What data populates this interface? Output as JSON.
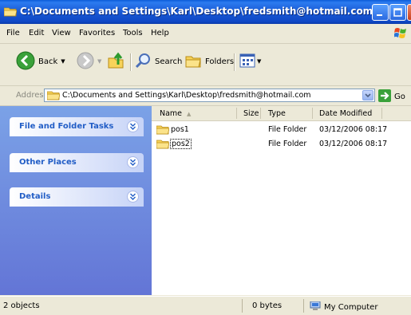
{
  "window": {
    "title": "C:\\Documents and Settings\\Karl\\Desktop\\fredsmith@hotmail.com"
  },
  "menu": {
    "items": [
      {
        "label": "File"
      },
      {
        "label": "Edit"
      },
      {
        "label": "View"
      },
      {
        "label": "Favorites"
      },
      {
        "label": "Tools"
      },
      {
        "label": "Help"
      }
    ]
  },
  "toolbar": {
    "back_label": "Back",
    "search_label": "Search",
    "folders_label": "Folders"
  },
  "address": {
    "label": "Address",
    "value": "C:\\Documents and Settings\\Karl\\Desktop\\fredsmith@hotmail.com",
    "go_label": "Go"
  },
  "taskpane": {
    "panels": [
      {
        "title": "File and Folder Tasks"
      },
      {
        "title": "Other Places"
      },
      {
        "title": "Details"
      }
    ]
  },
  "filelist": {
    "columns": [
      "Name",
      "Size",
      "Type",
      "Date Modified"
    ],
    "rows": [
      {
        "name": "pos1",
        "size": "",
        "type": "File Folder",
        "date": "03/12/2006 08:17"
      },
      {
        "name": "pos2",
        "size": "",
        "type": "File Folder",
        "date": "03/12/2006 08:17"
      }
    ]
  },
  "status": {
    "objects": "2 objects",
    "size": "0 bytes",
    "location": "My Computer"
  },
  "colors": {
    "titlebar": "#1959d4",
    "taskpane": "#6f8fe0",
    "panel_title": "#215dc6"
  }
}
